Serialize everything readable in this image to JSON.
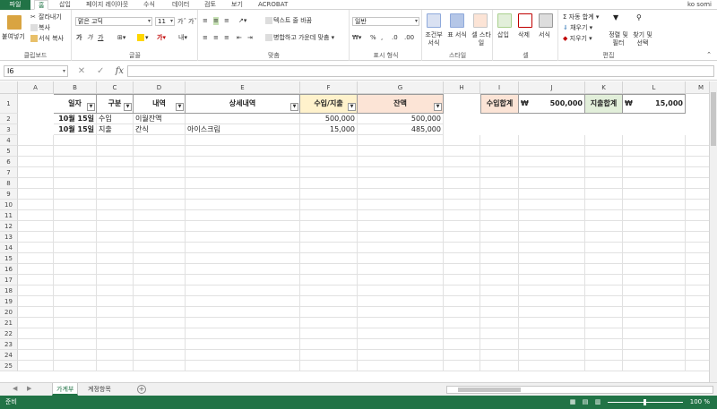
{
  "ribbon_tabs": [
    "파일",
    "홈",
    "삽입",
    "페이지 레이아웃",
    "수식",
    "데이터",
    "검토",
    "보기",
    "ACROBAT"
  ],
  "user_name": "ko somi",
  "clipboard": {
    "paste": "붙여넣기",
    "cut": "잘라내기",
    "copy": "복사",
    "format_painter": "서식 복사",
    "label": "클립보드"
  },
  "font": {
    "name": "맑은 고딕",
    "size": "11",
    "label": "글꼴",
    "bold": "가",
    "italic": "가",
    "underline": "가"
  },
  "alignment": {
    "wrap": "텍스트 줄 바꿈",
    "merge": "병합하고 가운데 맞춤",
    "label": "맞춤"
  },
  "number": {
    "format": "일반",
    "percent": "%",
    "comma": ",",
    "label": "표시 형식"
  },
  "styles": {
    "conditional": "조건부 서식",
    "table": "표 서식",
    "cell": "셀 스타일",
    "label": "스타일"
  },
  "cells": {
    "insert": "삽입",
    "delete": "삭제",
    "format": "서식",
    "label": "셀"
  },
  "editing": {
    "autosum": "자동 합계",
    "fill": "채우기",
    "clear": "지우기",
    "sort": "정렬 및 필터",
    "find": "찾기 및 선택",
    "label": "편집"
  },
  "name_box": "I6",
  "formula_icons": {
    "cancel": "✕",
    "enter": "✓",
    "fx": "fx"
  },
  "columns": [
    "A",
    "B",
    "C",
    "D",
    "E",
    "F",
    "G",
    "H",
    "I",
    "J",
    "K",
    "L",
    "M"
  ],
  "rows": [
    "1",
    "2",
    "3",
    "4",
    "5",
    "6",
    "7",
    "8",
    "9",
    "10",
    "11",
    "12",
    "13",
    "14",
    "15",
    "16",
    "17",
    "18",
    "19",
    "20",
    "21",
    "22",
    "23",
    "24",
    "25"
  ],
  "table": {
    "headers": [
      "일자",
      "구분",
      "내역",
      "상세내역",
      "수입/지출",
      "잔액"
    ],
    "rows": [
      [
        "10월 15일",
        "수입",
        "이월잔액",
        "",
        "500,000",
        "500,000"
      ],
      [
        "10월 15일",
        "지출",
        "간식",
        "아이스크림",
        "15,000",
        "485,000"
      ]
    ]
  },
  "summary": {
    "income_label": "수입합계",
    "income_currency": "₩",
    "income_value": "500,000",
    "expense_label": "지출합계",
    "expense_currency": "₩",
    "expense_value": "15,000"
  },
  "colors": {
    "excel_green": "#217346",
    "income_header": "#fff2cc",
    "balance_header": "#fce4d6",
    "expense_header": "#e2efda",
    "income_sum": "#fce4d6"
  },
  "sheets": [
    "가계부",
    "계정항목"
  ],
  "status": {
    "ready": "준비",
    "zoom": "100 %"
  }
}
